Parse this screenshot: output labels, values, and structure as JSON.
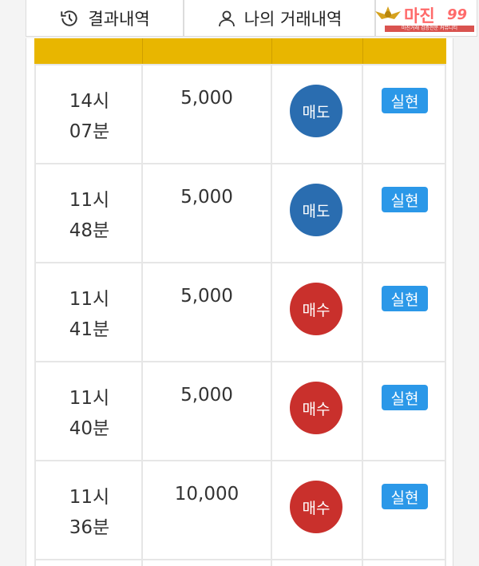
{
  "tabs": {
    "history_label": "결과내역",
    "mytrades_label": "나의 거래내역"
  },
  "logo": {
    "title": "마진",
    "subtitle": "마진거래 검증전문 커뮤니티"
  },
  "colors": {
    "header": "#e8b600",
    "sell": "#2a6db0",
    "buy": "#c9302c",
    "status": "#2b98e8"
  },
  "rows": [
    {
      "time_hour": "14시",
      "time_min": "07분",
      "amount": "5,000",
      "type": "매도",
      "status": "실현"
    },
    {
      "time_hour": "11시",
      "time_min": "48분",
      "amount": "5,000",
      "type": "매도",
      "status": "실현"
    },
    {
      "time_hour": "11시",
      "time_min": "41분",
      "amount": "5,000",
      "type": "매수",
      "status": "실현"
    },
    {
      "time_hour": "11시",
      "time_min": "40분",
      "amount": "5,000",
      "type": "매수",
      "status": "실현"
    },
    {
      "time_hour": "11시",
      "time_min": "36분",
      "amount": "10,000",
      "type": "매수",
      "status": "실현"
    }
  ]
}
